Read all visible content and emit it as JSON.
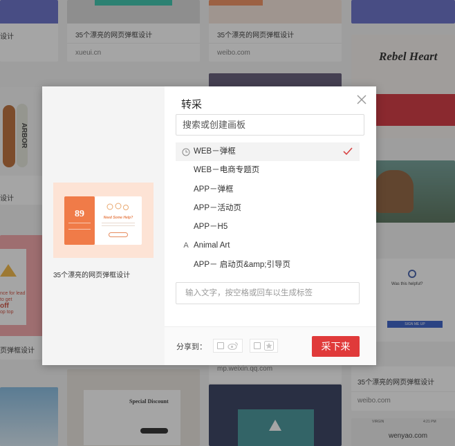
{
  "background": {
    "cards": [
      {
        "caption": "设计"
      },
      {
        "caption": "35个漂亮的网页弹框设计",
        "source": "xueui.cn"
      },
      {
        "caption": "35个漂亮的网页弹框设计",
        "source": "weibo.com"
      },
      {
        "caption": "设计"
      },
      {
        "caption": "页弹框设计"
      },
      {
        "caption": "35个漂亮的网页弹框设计",
        "source": "weibo.com"
      },
      {
        "source": "wenyao.com"
      },
      {
        "source": "mp.weixin.qq.com"
      }
    ],
    "art_texts": {
      "arbor": "ARBOR",
      "rebel": "Rebel Heart",
      "special": "Special Discount",
      "ribbon_lines": [
        "nce for lead",
        "to get",
        "off",
        "op top"
      ],
      "helpful": "Was this helpful?",
      "sign_up": "SIGN ME UP",
      "virgin": "VIRGIN",
      "time": "4:21 PM"
    }
  },
  "modal": {
    "title": "转采",
    "preview_caption": "35个漂亮的网页弹框设计",
    "preview_number": "89",
    "preview_headline": "Need Some Help?",
    "search_placeholder": "搜索或创建画板",
    "boards": [
      {
        "label": "WEB－弹框",
        "icon": "clock-icon",
        "selected": true
      },
      {
        "label": "WEB－电商专题页",
        "icon": "",
        "selected": false
      },
      {
        "label": "APP－弹框",
        "icon": "",
        "selected": false
      },
      {
        "label": "APP－活动页",
        "icon": "",
        "selected": false
      },
      {
        "label": "APP－H5",
        "icon": "",
        "selected": false
      },
      {
        "label": "Animal Art",
        "icon": "A",
        "selected": false
      },
      {
        "label": "APP－ 启动页&amp;引导页",
        "icon": "",
        "selected": false
      }
    ],
    "tag_placeholder": "输入文字，按空格或回车以生成标签",
    "share_label": "分享到：",
    "share_targets": [
      "weibo-icon",
      "qzone-icon"
    ],
    "submit_label": "采下来",
    "accent": "#e03a3a"
  }
}
